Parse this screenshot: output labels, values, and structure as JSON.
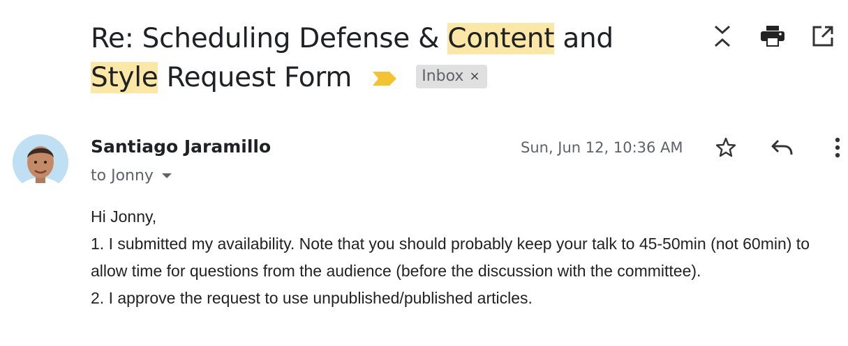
{
  "email": {
    "subject_parts": {
      "p1": "Re: Scheduling Defense & ",
      "h1": "Content",
      "p2": " and",
      "h2": "Style",
      "p3": " Request Form"
    },
    "label": "Inbox",
    "label_remove": "×",
    "sender": "Santiago Jaramillo",
    "recipient": "to Jonny",
    "date": "Sun, Jun 12, 10:36 AM",
    "body": [
      "Hi Jonny,",
      "1. I submitted my availability. Note that you should probably keep your talk to 45-50min (not 60min) to allow time for questions from the audience (before the discussion with the committee).",
      "2. I approve the request to use unpublished/published articles."
    ]
  },
  "icons": {
    "top": [
      "collapse-icon",
      "print-icon",
      "open-in-new-window-icon"
    ],
    "message": [
      "star-icon",
      "reply-icon",
      "more-vert-icon"
    ],
    "importance": "importance-marker-icon"
  },
  "colors": {
    "highlight": "#fce8a6",
    "importance": "#f4c430",
    "chip_bg": "#e0e0e0"
  }
}
